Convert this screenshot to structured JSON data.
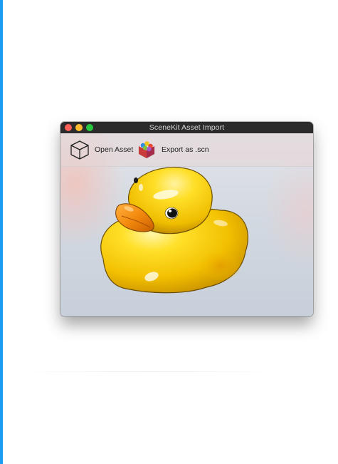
{
  "window": {
    "title": "SceneKit Asset Import"
  },
  "toolbar": {
    "open_label": "Open Asset",
    "export_label": "Export as .scn"
  },
  "icons": {
    "open": "cube-icon",
    "export": "scenekit-icon"
  },
  "colors": {
    "accent": "#1a9cf2",
    "titlebar": "#2b2b2b",
    "close": "#fe5f57",
    "minimize": "#febc2e",
    "maximize": "#28c840",
    "duck_body": "#f2c500",
    "duck_beak": "#f08a10"
  }
}
